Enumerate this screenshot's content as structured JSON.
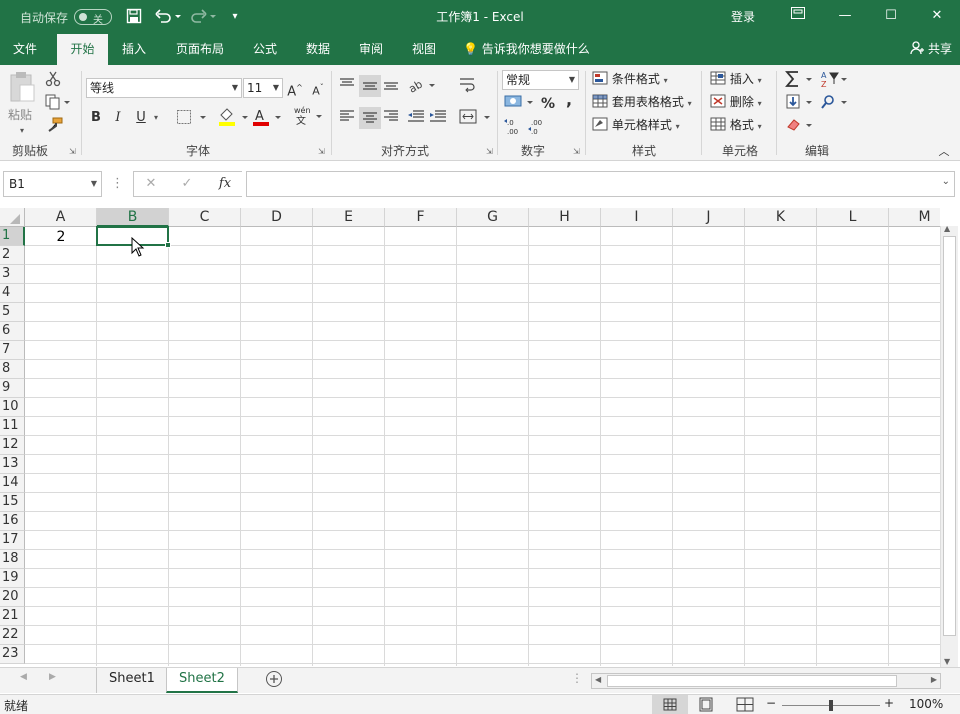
{
  "titlebar": {
    "autosave_label": "自动保存",
    "autosave_state": "关",
    "title": "工作簿1  -  Excel",
    "login": "登录"
  },
  "tabs": [
    "文件",
    "开始",
    "插入",
    "页面布局",
    "公式",
    "数据",
    "审阅",
    "视图"
  ],
  "active_tab": "开始",
  "tell_me": "告诉我你想要做什么",
  "share": "共享",
  "ribbon": {
    "clipboard": {
      "label": "剪贴板",
      "paste": "粘贴"
    },
    "font": {
      "label": "字体",
      "font_name": "等线",
      "font_size": "11",
      "bold": "B",
      "italic": "I",
      "underline": "U"
    },
    "alignment": {
      "label": "对齐方式"
    },
    "number": {
      "label": "数字",
      "format": "常规",
      "percent": "%",
      "comma": ","
    },
    "styles": {
      "label": "样式",
      "conditional": "条件格式",
      "table": "套用表格格式",
      "cell_styles": "单元格样式"
    },
    "cells": {
      "label": "单元格",
      "insert": "插入",
      "delete": "删除",
      "format": "格式"
    },
    "editing": {
      "label": "编辑"
    }
  },
  "formula_bar": {
    "name_box": "B1",
    "fx": "fx",
    "content": ""
  },
  "columns": [
    "A",
    "B",
    "C",
    "D",
    "E",
    "F",
    "G",
    "H",
    "I",
    "J",
    "K",
    "L",
    "M"
  ],
  "rows": [
    "1",
    "2",
    "3",
    "4",
    "5",
    "6",
    "7",
    "8",
    "9",
    "10",
    "11",
    "12",
    "13",
    "14",
    "15",
    "16",
    "17",
    "18",
    "19",
    "20",
    "21",
    "22",
    "23"
  ],
  "cells": {
    "A1": "2"
  },
  "sheets": [
    "Sheet1",
    "Sheet2"
  ],
  "active_sheet": "Sheet2",
  "status": {
    "ready": "就绪",
    "zoom": "100%"
  },
  "colors": {
    "accent": "#217346"
  }
}
